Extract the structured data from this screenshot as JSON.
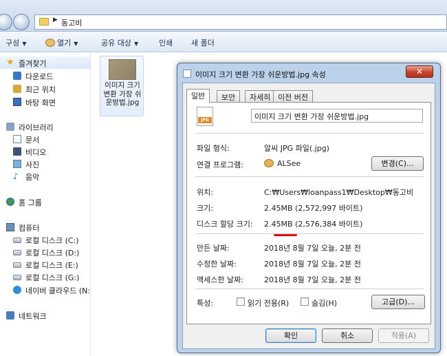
{
  "address": {
    "crumb": "동고비"
  },
  "toolbar": {
    "organize": "구성",
    "open": "열기",
    "share": "공유 대상",
    "print": "인쇄",
    "new_folder": "새 폴더"
  },
  "sidebar": {
    "favorites": "즐겨찾기",
    "downloads": "다운로드",
    "recent": "최근 위치",
    "desktop": "바탕 화면",
    "libraries": "라이브러리",
    "documents": "문서",
    "videos": "비디오",
    "pictures": "사진",
    "music": "음악",
    "homegroup": "홈 그룹",
    "computer": "컴퓨터",
    "disk_c": "로컬 디스크 (C:)",
    "disk_d": "로컬 디스크 (D:)",
    "disk_e": "로컬 디스크 (E:)",
    "disk_g": "로컬 디스크 (G:)",
    "naver_cloud": "네이버 클라우드 (N:",
    "network": "네트워크"
  },
  "file": {
    "name": "이미지 크기 변환 가장 쉬운방법.jpg",
    "icon_label": "JPG"
  },
  "dialog": {
    "title": "이미지 크기 변환 가장 쉬운방법.jpg 속성",
    "close": "✕",
    "tabs": [
      "일반",
      "보안",
      "자세히",
      "이전 버전"
    ],
    "filename": "이미지 크기 변환 가장 쉬운방법.jpg",
    "file_type_label": "파일 형식:",
    "file_type_value": "알씨 JPG 파일(.jpg)",
    "opens_with_label": "연결 프로그램:",
    "opens_with_value": "ALSee",
    "change_button": "변경(C)...",
    "location_label": "위치:",
    "location_value": "C:₩Users₩loanpass1₩Desktop₩동고비",
    "size_label": "크기:",
    "size_value": "2.45MB (2,572,997 바이트)",
    "size_on_disk_label": "디스크 할당 크기:",
    "size_on_disk_value": "2.45MB (2,576,384 바이트)",
    "created_label": "만든 날짜:",
    "created_value": "2018년 8월 7일 오늘, 2분 전",
    "modified_label": "수정한 날짜:",
    "modified_value": "2018년 8월 7일 오늘, 2분 전",
    "accessed_label": "액세스한 날짜:",
    "accessed_value": "2018년 8월 7일 오늘, 2분 전",
    "attributes_label": "특성:",
    "readonly_label": "읽기 전용(R)",
    "hidden_label": "숨김(H)",
    "advanced_button": "고급(D)...",
    "ok_button": "확인",
    "cancel_button": "취소",
    "apply_button": "적용(A)"
  },
  "colors": {
    "highlight_underline": "#e0120f",
    "dialog_frame": "#bcd1ea"
  }
}
